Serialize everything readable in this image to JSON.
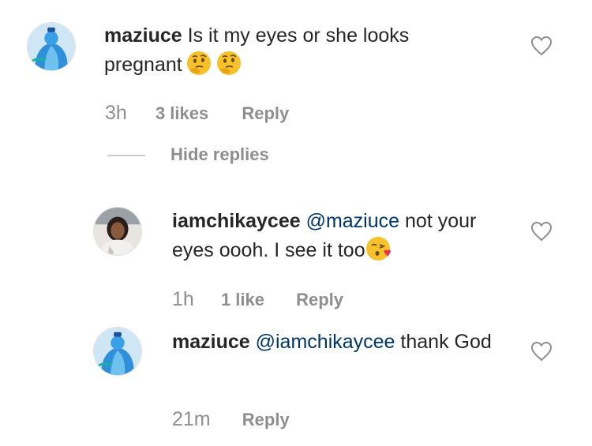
{
  "comments": [
    {
      "username": "maziuce",
      "mention": "",
      "text": "Is it my eyes or she looks pregnant",
      "emojis": [
        "thinking-face",
        "thinking-face"
      ],
      "time": "3h",
      "likes": "3 likes",
      "reply_label": "Reply"
    },
    {
      "username": "iamchikaycee",
      "mention": "@maziuce",
      "text": "not your eyes oooh. I see it too",
      "emojis": [
        "kissing-face-heart"
      ],
      "time": "1h",
      "likes": "1 like",
      "reply_label": "Reply"
    },
    {
      "username": "maziuce",
      "mention": "@iamchikaycee",
      "text": "thank God",
      "emojis": [],
      "time": "21m",
      "likes": "",
      "reply_label": "Reply"
    }
  ],
  "hide_replies_label": "Hide replies",
  "colors": {
    "text": "#262626",
    "mention": "#003569",
    "meta": "#8e8e8e",
    "emoji": "#f7c12b"
  }
}
